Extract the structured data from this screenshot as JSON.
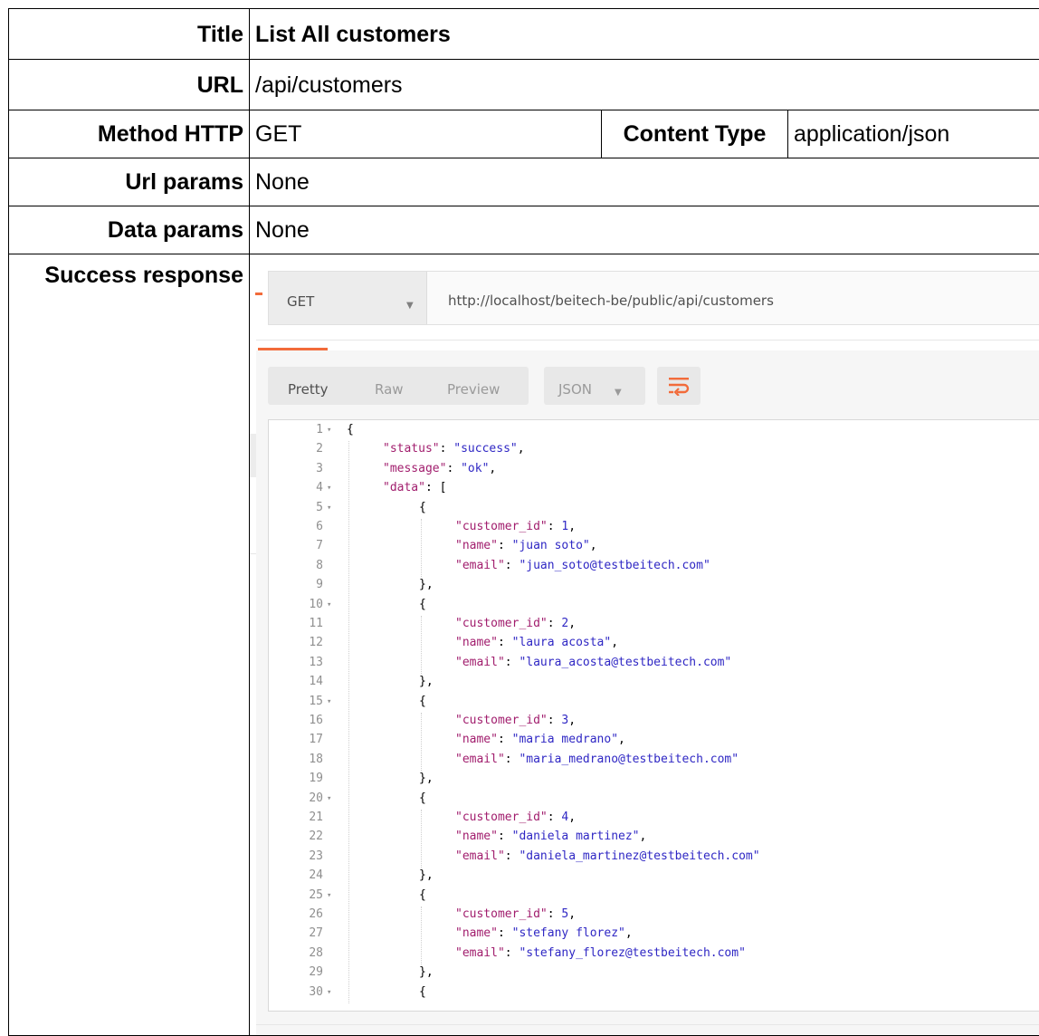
{
  "rows": {
    "title": {
      "label": "Title",
      "value": "List All customers"
    },
    "url": {
      "label": "URL",
      "value": "/api/customers"
    },
    "method": {
      "label": "Method HTTP",
      "value": "GET",
      "content_type_label": "Content Type",
      "content_type_value": "application/json"
    },
    "url_params": {
      "label": "Url params",
      "value": "None"
    },
    "data_params": {
      "label": "Data params",
      "value": "None"
    },
    "success": {
      "label": "Success response"
    }
  },
  "screenshot": {
    "method": "GET",
    "url": "http://localhost/beitech-be/public/api/customers",
    "format_tabs": [
      "Pretty",
      "Raw",
      "Preview"
    ],
    "format_select": "JSON",
    "icons": {
      "method_caret": "chevron-down-icon",
      "json_caret": "chevron-down-icon",
      "wrap": "wrap-lines-icon",
      "fold": "fold-caret-icon"
    },
    "colors": {
      "accent": "#f26b3a",
      "key": "#a11d6d",
      "string": "#2f27c4"
    },
    "code_lines": [
      {
        "n": "1",
        "fold": true,
        "indent": 0,
        "parts": [
          {
            "t": "{",
            "c": "p"
          }
        ]
      },
      {
        "n": "2",
        "fold": false,
        "indent": 1,
        "parts": [
          {
            "t": "\"status\"",
            "c": "k"
          },
          {
            "t": ": ",
            "c": "p"
          },
          {
            "t": "\"success\"",
            "c": "s"
          },
          {
            "t": ",",
            "c": "p"
          }
        ]
      },
      {
        "n": "3",
        "fold": false,
        "indent": 1,
        "parts": [
          {
            "t": "\"message\"",
            "c": "k"
          },
          {
            "t": ": ",
            "c": "p"
          },
          {
            "t": "\"ok\"",
            "c": "s"
          },
          {
            "t": ",",
            "c": "p"
          }
        ]
      },
      {
        "n": "4",
        "fold": true,
        "indent": 1,
        "parts": [
          {
            "t": "\"data\"",
            "c": "k"
          },
          {
            "t": ": [",
            "c": "p"
          }
        ]
      },
      {
        "n": "5",
        "fold": true,
        "indent": 2,
        "parts": [
          {
            "t": "{",
            "c": "p"
          }
        ]
      },
      {
        "n": "6",
        "fold": false,
        "indent": 3,
        "parts": [
          {
            "t": "\"customer_id\"",
            "c": "k"
          },
          {
            "t": ": ",
            "c": "p"
          },
          {
            "t": "1",
            "c": "n"
          },
          {
            "t": ",",
            "c": "p"
          }
        ]
      },
      {
        "n": "7",
        "fold": false,
        "indent": 3,
        "parts": [
          {
            "t": "\"name\"",
            "c": "k"
          },
          {
            "t": ": ",
            "c": "p"
          },
          {
            "t": "\"juan soto\"",
            "c": "s"
          },
          {
            "t": ",",
            "c": "p"
          }
        ]
      },
      {
        "n": "8",
        "fold": false,
        "indent": 3,
        "parts": [
          {
            "t": "\"email\"",
            "c": "k"
          },
          {
            "t": ": ",
            "c": "p"
          },
          {
            "t": "\"juan_soto@testbeitech.com\"",
            "c": "s"
          }
        ]
      },
      {
        "n": "9",
        "fold": false,
        "indent": 2,
        "parts": [
          {
            "t": "},",
            "c": "p"
          }
        ]
      },
      {
        "n": "10",
        "fold": true,
        "indent": 2,
        "parts": [
          {
            "t": "{",
            "c": "p"
          }
        ]
      },
      {
        "n": "11",
        "fold": false,
        "indent": 3,
        "parts": [
          {
            "t": "\"customer_id\"",
            "c": "k"
          },
          {
            "t": ": ",
            "c": "p"
          },
          {
            "t": "2",
            "c": "n"
          },
          {
            "t": ",",
            "c": "p"
          }
        ]
      },
      {
        "n": "12",
        "fold": false,
        "indent": 3,
        "parts": [
          {
            "t": "\"name\"",
            "c": "k"
          },
          {
            "t": ": ",
            "c": "p"
          },
          {
            "t": "\"laura acosta\"",
            "c": "s"
          },
          {
            "t": ",",
            "c": "p"
          }
        ]
      },
      {
        "n": "13",
        "fold": false,
        "indent": 3,
        "parts": [
          {
            "t": "\"email\"",
            "c": "k"
          },
          {
            "t": ": ",
            "c": "p"
          },
          {
            "t": "\"laura_acosta@testbeitech.com\"",
            "c": "s"
          }
        ]
      },
      {
        "n": "14",
        "fold": false,
        "indent": 2,
        "parts": [
          {
            "t": "},",
            "c": "p"
          }
        ]
      },
      {
        "n": "15",
        "fold": true,
        "indent": 2,
        "parts": [
          {
            "t": "{",
            "c": "p"
          }
        ]
      },
      {
        "n": "16",
        "fold": false,
        "indent": 3,
        "parts": [
          {
            "t": "\"customer_id\"",
            "c": "k"
          },
          {
            "t": ": ",
            "c": "p"
          },
          {
            "t": "3",
            "c": "n"
          },
          {
            "t": ",",
            "c": "p"
          }
        ]
      },
      {
        "n": "17",
        "fold": false,
        "indent": 3,
        "parts": [
          {
            "t": "\"name\"",
            "c": "k"
          },
          {
            "t": ": ",
            "c": "p"
          },
          {
            "t": "\"maria medrano\"",
            "c": "s"
          },
          {
            "t": ",",
            "c": "p"
          }
        ]
      },
      {
        "n": "18",
        "fold": false,
        "indent": 3,
        "parts": [
          {
            "t": "\"email\"",
            "c": "k"
          },
          {
            "t": ": ",
            "c": "p"
          },
          {
            "t": "\"maria_medrano@testbeitech.com\"",
            "c": "s"
          }
        ]
      },
      {
        "n": "19",
        "fold": false,
        "indent": 2,
        "parts": [
          {
            "t": "},",
            "c": "p"
          }
        ]
      },
      {
        "n": "20",
        "fold": true,
        "indent": 2,
        "parts": [
          {
            "t": "{",
            "c": "p"
          }
        ]
      },
      {
        "n": "21",
        "fold": false,
        "indent": 3,
        "parts": [
          {
            "t": "\"customer_id\"",
            "c": "k"
          },
          {
            "t": ": ",
            "c": "p"
          },
          {
            "t": "4",
            "c": "n"
          },
          {
            "t": ",",
            "c": "p"
          }
        ]
      },
      {
        "n": "22",
        "fold": false,
        "indent": 3,
        "parts": [
          {
            "t": "\"name\"",
            "c": "k"
          },
          {
            "t": ": ",
            "c": "p"
          },
          {
            "t": "\"daniela martinez\"",
            "c": "s"
          },
          {
            "t": ",",
            "c": "p"
          }
        ]
      },
      {
        "n": "23",
        "fold": false,
        "indent": 3,
        "parts": [
          {
            "t": "\"email\"",
            "c": "k"
          },
          {
            "t": ": ",
            "c": "p"
          },
          {
            "t": "\"daniela_martinez@testbeitech.com\"",
            "c": "s"
          }
        ]
      },
      {
        "n": "24",
        "fold": false,
        "indent": 2,
        "parts": [
          {
            "t": "},",
            "c": "p"
          }
        ]
      },
      {
        "n": "25",
        "fold": true,
        "indent": 2,
        "parts": [
          {
            "t": "{",
            "c": "p"
          }
        ]
      },
      {
        "n": "26",
        "fold": false,
        "indent": 3,
        "parts": [
          {
            "t": "\"customer_id\"",
            "c": "k"
          },
          {
            "t": ": ",
            "c": "p"
          },
          {
            "t": "5",
            "c": "n"
          },
          {
            "t": ",",
            "c": "p"
          }
        ]
      },
      {
        "n": "27",
        "fold": false,
        "indent": 3,
        "parts": [
          {
            "t": "\"name\"",
            "c": "k"
          },
          {
            "t": ": ",
            "c": "p"
          },
          {
            "t": "\"stefany florez\"",
            "c": "s"
          },
          {
            "t": ",",
            "c": "p"
          }
        ]
      },
      {
        "n": "28",
        "fold": false,
        "indent": 3,
        "parts": [
          {
            "t": "\"email\"",
            "c": "k"
          },
          {
            "t": ": ",
            "c": "p"
          },
          {
            "t": "\"stefany_florez@testbeitech.com\"",
            "c": "s"
          }
        ]
      },
      {
        "n": "29",
        "fold": false,
        "indent": 2,
        "parts": [
          {
            "t": "},",
            "c": "p"
          }
        ]
      },
      {
        "n": "30",
        "fold": true,
        "indent": 2,
        "parts": [
          {
            "t": "{",
            "c": "p"
          }
        ]
      }
    ]
  }
}
